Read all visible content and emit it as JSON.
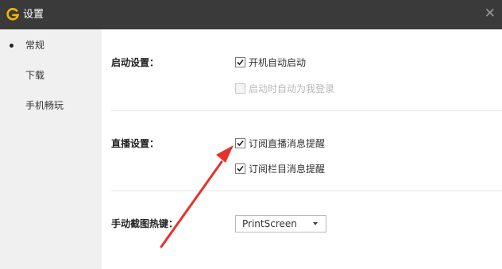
{
  "window": {
    "title": "设置",
    "close_icon": "close-icon",
    "logo_icon": "logo-g-icon",
    "logo_color": "#f5b800"
  },
  "sidebar": {
    "items": [
      {
        "label": "常规",
        "selected": true
      },
      {
        "label": "下载",
        "selected": false
      },
      {
        "label": "手机畅玩",
        "selected": false
      }
    ]
  },
  "settings": {
    "startup": {
      "label": "启动设置：",
      "options": [
        {
          "label": "开机自动启动",
          "checked": true,
          "enabled": true
        },
        {
          "label": "启动时自动为我登录",
          "checked": false,
          "enabled": false
        }
      ]
    },
    "live": {
      "label": "直播设置：",
      "options": [
        {
          "label": "订阅直播消息提醒",
          "checked": true,
          "enabled": true
        },
        {
          "label": "订阅栏目消息提醒",
          "checked": true,
          "enabled": true
        }
      ]
    },
    "hotkey": {
      "label": "手动截图热键：",
      "value": "PrintScreen"
    }
  },
  "annotation": {
    "arrow_color": "#e8312a"
  }
}
